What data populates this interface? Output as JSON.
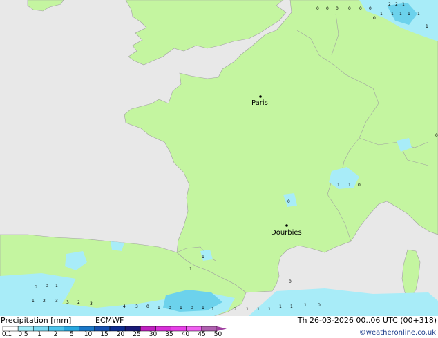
{
  "colors": {
    "sea": "#e8e8e8",
    "land": "#c4f5a0",
    "border": "#a0a0a0",
    "light_precip": "#a8ecf8",
    "medium_precip": "#6cd2ec"
  },
  "cities": [
    {
      "name": "Paris"
    },
    {
      "name": "Dourbies"
    }
  ],
  "precip_values": [
    "2",
    "2",
    "1",
    "1",
    "1",
    "1",
    "1",
    "1",
    "1",
    "0",
    "0",
    "0",
    "0",
    "0",
    "0",
    "0",
    "0",
    "1",
    "1",
    "0",
    "1",
    "0",
    "1",
    "0",
    "0",
    "0",
    "1",
    "1",
    "2",
    "3",
    "3",
    "2",
    "3",
    "4",
    "3",
    "0",
    "1",
    "0",
    "1",
    "0",
    "1",
    "1",
    "0",
    "1",
    "1",
    "1",
    "1",
    "1",
    "1",
    "0"
  ],
  "legend": {
    "title": "Precipitation [mm]",
    "model": "ECMWF",
    "scale_labels": [
      "0.1",
      "0.5",
      "1",
      "2",
      "5",
      "10",
      "15",
      "20",
      "25",
      "30",
      "35",
      "40",
      "45",
      "50"
    ],
    "scale_colors": [
      "#ffffff",
      "#a0ecf8",
      "#7ad8f0",
      "#4cc4ec",
      "#28a8e0",
      "#1a78c8",
      "#1450b0",
      "#0c2c90",
      "#1a1a78",
      "#c020c0",
      "#d830d8",
      "#e840e8",
      "#f060f0",
      "#b060b0"
    ]
  },
  "valid_time": "Th 26-03-2026 00..06 UTC (00+318)",
  "credit": "©weatheronline.co.uk"
}
